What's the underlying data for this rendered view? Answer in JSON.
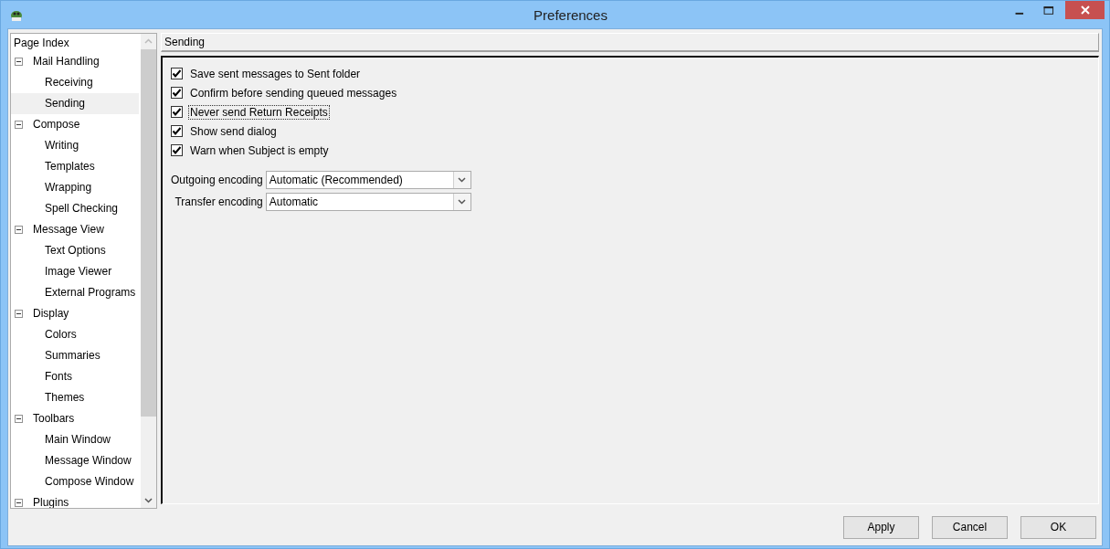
{
  "window": {
    "title": "Preferences"
  },
  "sidebar": {
    "header": "Page Index",
    "items": [
      {
        "label": "Mail Handling",
        "expanded": true,
        "selected": false,
        "children": [
          {
            "label": "Receiving",
            "selected": false
          },
          {
            "label": "Sending",
            "selected": true
          }
        ]
      },
      {
        "label": "Compose",
        "expanded": true,
        "selected": false,
        "children": [
          {
            "label": "Writing",
            "selected": false
          },
          {
            "label": "Templates",
            "selected": false
          },
          {
            "label": "Wrapping",
            "selected": false
          },
          {
            "label": "Spell Checking",
            "selected": false
          }
        ]
      },
      {
        "label": "Message View",
        "expanded": true,
        "selected": false,
        "children": [
          {
            "label": "Text Options",
            "selected": false
          },
          {
            "label": "Image Viewer",
            "selected": false
          },
          {
            "label": "External Programs",
            "selected": false
          }
        ]
      },
      {
        "label": "Display",
        "expanded": true,
        "selected": false,
        "children": [
          {
            "label": "Colors",
            "selected": false
          },
          {
            "label": "Summaries",
            "selected": false
          },
          {
            "label": "Fonts",
            "selected": false
          },
          {
            "label": "Themes",
            "selected": false
          }
        ]
      },
      {
        "label": "Toolbars",
        "expanded": true,
        "selected": false,
        "children": [
          {
            "label": "Main Window",
            "selected": false
          },
          {
            "label": "Message Window",
            "selected": false
          },
          {
            "label": "Compose Window",
            "selected": false
          }
        ]
      },
      {
        "label": "Plugins",
        "expanded": true,
        "selected": false
      }
    ]
  },
  "page": {
    "title": "Sending",
    "checkboxes": [
      {
        "label": "Save sent messages to Sent folder",
        "checked": true,
        "focused": false
      },
      {
        "label": "Confirm before sending queued messages",
        "checked": true,
        "focused": false
      },
      {
        "label": "Never send Return Receipts",
        "checked": true,
        "focused": true
      },
      {
        "label": "Show send dialog",
        "checked": true,
        "focused": false
      },
      {
        "label": "Warn when Subject is empty",
        "checked": true,
        "focused": false
      }
    ],
    "selects": [
      {
        "label": "Outgoing encoding",
        "value": "Automatic (Recommended)"
      },
      {
        "label": "Transfer encoding",
        "value": "Automatic"
      }
    ]
  },
  "buttons": [
    "Apply",
    "Cancel",
    "OK"
  ]
}
